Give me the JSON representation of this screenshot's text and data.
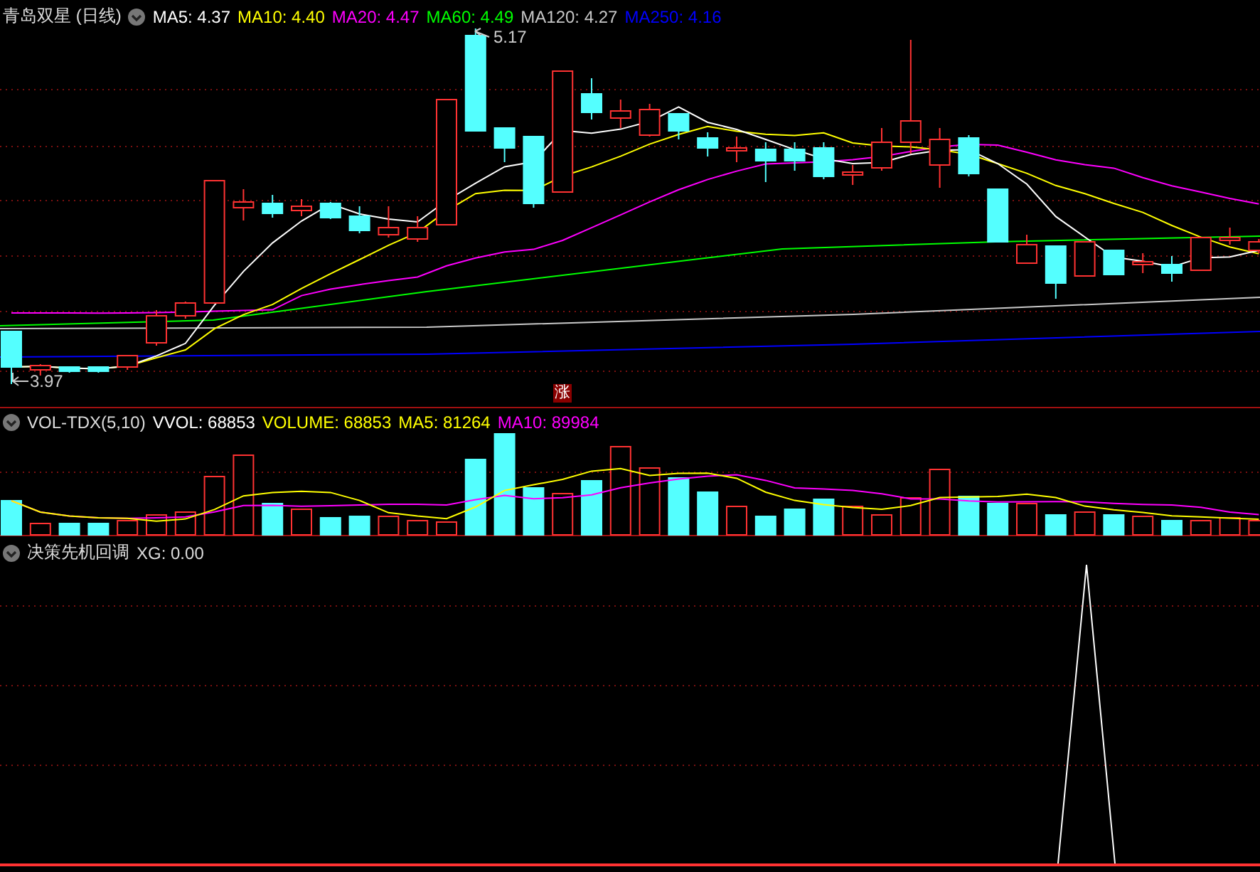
{
  "price_panel": {
    "title": "青岛双星 (日线)",
    "indicators": [
      {
        "label": "MA5: 4.37",
        "color": "#ffffff"
      },
      {
        "label": "MA10: 4.40",
        "color": "#ffff00"
      },
      {
        "label": "MA20: 4.47",
        "color": "#ff00ff"
      },
      {
        "label": "MA60: 4.49",
        "color": "#00ff00"
      },
      {
        "label": "MA120: 4.27",
        "color": "#c8c8c8"
      },
      {
        "label": "MA250: 4.16",
        "color": "#0000ff"
      }
    ],
    "high_label": "5.17",
    "low_label": "3.97",
    "badge": "涨"
  },
  "volume_panel": {
    "title": "VOL-TDX(5,10)",
    "indicators": [
      {
        "label": "VVOL: 68853",
        "color": "#ffffff"
      },
      {
        "label": "VOLUME: 68853",
        "color": "#ffff00"
      },
      {
        "label": "MA5: 81264",
        "color": "#ffff00"
      },
      {
        "label": "MA10: 89984",
        "color": "#ff00ff"
      }
    ]
  },
  "signal_panel": {
    "title": "决策先机回调",
    "indicators": [
      {
        "label": "XG: 0.00",
        "color": "#dcdcdc"
      }
    ]
  }
}
